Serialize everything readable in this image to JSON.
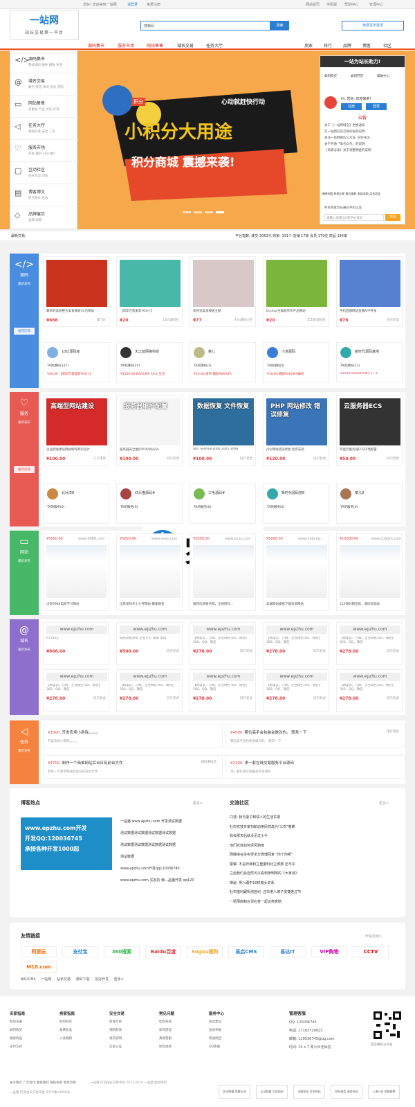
{
  "topbar": {
    "welcome": "您好! 欢迎来到一站网",
    "login": "请登录",
    "register": "免费注册",
    "site_home": "网站首页",
    "mobile": "手机版",
    "help": "帮助中心",
    "manage": "管理中心"
  },
  "header": {
    "logo": "一站网",
    "slogan": "站长交易第一平台",
    "search_placeholder": "搜索码",
    "search_btn": "搜索",
    "free_btn": "免费发布需求"
  },
  "nav": {
    "items": [
      "源码集市",
      "服务市场",
      "网站售售",
      "域名交易",
      "任务大厅"
    ],
    "right": [
      "卖家",
      "排行",
      "品牌",
      "博客",
      "社区"
    ]
  },
  "sidemenu": [
    {
      "icon": "</>",
      "title": "源码集市",
      "sub": "整站源码 插件 模板 更多"
    },
    {
      "icon": "@",
      "title": "域名交易",
      "sub": "数字 拼音 单词 杂米 求购"
    },
    {
      "icon": "▭",
      "title": "网站售售",
      "sub": "权重站 行业 论坛 外贸"
    },
    {
      "icon": "◁",
      "title": "任务大厅",
      "sub": "网站开发 安全 二开"
    },
    {
      "icon": "♡",
      "title": "服务市场",
      "sub": "开发 维护 SEO 推广"
    },
    {
      "icon": "▢",
      "title": "互动社区",
      "sub": "站长交流 问答"
    },
    {
      "icon": "▤",
      "title": "博客博文",
      "sub": "热点博文 经验"
    },
    {
      "icon": "◇",
      "title": "品牌展示",
      "sub": "品牌 商家"
    }
  ],
  "banner": {
    "tag": "积分",
    "line1": "心动就赶快行动",
    "big1": "小积分大用途",
    "big2": "积分商城 震撼来袭!"
  },
  "rpanel": {
    "title": "一站为站长助力!",
    "icons": [
      "如何购买",
      "如何开店",
      "帮助中心"
    ],
    "welcome": "Hi, 您好, 欢迎来到!",
    "login": "注册",
    "reg": "登录",
    "notice_title": "公告",
    "notices": [
      "关于【一站网域名】更换通知",
      "在一站网开店交易的规则说明",
      "关注一站网微信公众号, 好好关注",
      "关于开通「承包众包」的说明",
      "《商家必读》关于调整佣金的说明"
    ],
    "services": [
      "快捷充值",
      "担保交易",
      "售后维权",
      "发起求助",
      "实名验证"
    ],
    "qq_tip": "所有商家均已通过手机认证",
    "qq_input": "请输入商家QQ或手机号码",
    "qq_btn": "验证"
  },
  "deal": {
    "label": "最新交易:",
    "stats": "平台指数: 成交 2063元 商家: 331个 店铺 17家 会员 179位 商品 184家"
  },
  "source": {
    "name": "源码",
    "more": "最新发布",
    "shop_tag": "推荐店铺",
    "cards": [
      {
        "title": "最新的美丽整合美食模板VC包网站",
        "price": "¥666",
        "shop": "城飞达",
        "color": "#c9321d"
      },
      {
        "title": "【周年在售服装YOU+】",
        "price": "¥20",
        "shop": "13亿源码社",
        "color": "#48b8a8"
      },
      {
        "title": "新视觉美妆模板主题",
        "price": "¥77",
        "shop": "大头源码小店",
        "color": "#d8c8c8"
      },
      {
        "title": "Ecshop生鲜超市农产品网站",
        "price": "¥20",
        "shop": "丰丰的源码社",
        "color": "#7cb53b"
      },
      {
        "title": "手机直播网站直播APP开发",
        "price": "¥76",
        "shop": "同只老虎",
        "color": "#5680d0"
      }
    ],
    "shops": [
      {
        "name": "10亿源码库",
        "count": "TA的源码(127)",
        "price": "¥20.00 【周年在售服装YOU+】",
        "color": "#7fb0e0"
      },
      {
        "name": "天之蓝网络科技",
        "count": "TA的源码(25)",
        "price": "¥1000.00 BAOCMS 30.1 生活",
        "color": "#333"
      },
      {
        "name": "菜儿",
        "count": "TA的源码(1)",
        "price": "¥10.00 发布 最新92KAIFA",
        "color": "#bb8"
      },
      {
        "name": "小涛源码",
        "count": "TA的源码(5)",
        "price": "¥10.00 最新92KAIFA编码",
        "color": "#3a7ed8"
      },
      {
        "name": "新时代源码基地",
        "count": "TA的源码(11)",
        "price": "¥1000.00 BAOCMS 17.1",
        "color": "#3aa"
      }
    ]
  },
  "service": {
    "name": "服务",
    "more": "最新发布",
    "shop_tag": "推荐店铺",
    "cards": [
      {
        "title": "企业网站建设网站制作网页设计",
        "price": "¥100.00",
        "shop": "三只电商",
        "label": "高端型网站建设",
        "color": "#d42a2a"
      },
      {
        "title": "服务器安全维护PHP/MySQL",
        "price": "¥100.00",
        "shop": "同只老虎",
        "label": "服务器维护配置",
        "color": "#f5f5f5"
      },
      {
        "title": "SQL SERVER2000 2005 2008",
        "price": "¥100.00",
        "shop": "同只老虎",
        "label": "数据恢复 文件恢复",
        "color": "#2d6e9c"
      },
      {
        "title": "php网站错误修复 程序安装",
        "price": "¥120.00",
        "shop": "同只老虎",
        "label": "PHP 网站修改 错误修复",
        "color": "#3a75b8"
      },
      {
        "title": "阿里云服务器ECS环境配置",
        "price": "¥50.00",
        "shop": "同只老虎",
        "label": "云服务器ECS",
        "color": "#333"
      }
    ],
    "shops": [
      {
        "name": "北冰洋8",
        "count": "TA的服务(0)",
        "color": "#c84"
      },
      {
        "name": "红头猫源码#",
        "count": "TA的服务(0)",
        "color": "#a44"
      },
      {
        "name": "三毛源码#",
        "count": "TA的服务(0)",
        "color": "#7b5"
      },
      {
        "name": "新时代源码技8",
        "count": "TA的服务(0)",
        "color": "#3aa"
      },
      {
        "name": "菜儿8",
        "count": "TA的服务(0)",
        "color": "#a75"
      }
    ]
  },
  "website": {
    "name": "网站",
    "more": "最新发布",
    "cards": [
      {
        "title": "出售9988电商学习网站",
        "price": "¥5000.00",
        "url": "www.9988.com"
      },
      {
        "title": "出售某技术七七寺网站-聚集销售",
        "price": "¥5000.00",
        "url": "www.xxxx.com"
      },
      {
        "title": "推荐优质服务网，正规授权...",
        "price": "¥5000.00",
        "url": "www.xxxx.com"
      },
      {
        "title": "高端网站模板下载资源网站",
        "price": "¥5000.00",
        "url": "www.diqiong..."
      },
      {
        "title": "119源码网出售，源码资源站",
        "price": "¥15000.00",
        "url": "www.119ym.com"
      }
    ]
  },
  "watermark": {
    "text": "罗网"
  },
  "domain": {
    "name": "域名",
    "more": "最新发布",
    "cards": [
      {
        "domain": "www.epzhu.com",
        "desc": "675423",
        "price": "¥666.00",
        "shop": ""
      },
      {
        "domain": "www.epzhu.com",
        "desc": "域名寄售测试 企业七七 家居 测试",
        "price": "¥500.00",
        "shop": "同只老虎"
      },
      {
        "domain": "www.epzhu.com",
        "desc": "【网里云、万网、企业域名 bei、域名】360、QQ、微信",
        "price": "¥278.00",
        "shop": "同只老虎"
      },
      {
        "domain": "www.epzhu.com",
        "desc": "【网里云、万网、企业域名 bei、域名】360、QQ、微信",
        "price": "¥278.00",
        "shop": "同只老虎"
      },
      {
        "domain": "www.epzhu.com",
        "desc": "【网里云、万网、企业域名 bei、域名】360、QQ、微信",
        "price": "¥278.00",
        "shop": "同只老虎"
      },
      {
        "domain": "www.epzhu.com",
        "desc": "【网里云、万网、企业域名 bei、域名】360、QQ、微信",
        "price": "¥278.00",
        "shop": "同只老虎"
      },
      {
        "domain": "www.epzhu.com",
        "desc": "【网里云、万网、企业域名 bei、域名】360、QQ、微信",
        "price": "¥278.00",
        "shop": "同只老虎"
      },
      {
        "domain": "www.epzhu.com",
        "desc": "【网里云、万网、企业域名 bei、域名】360、QQ、微信",
        "price": "¥278.00",
        "shop": "同只老虎"
      },
      {
        "domain": "www.epzhu.com",
        "desc": "【网里云、万网、企业域名 bei、域名】360、QQ、微信",
        "price": "¥278.00",
        "shop": "同只老虎"
      },
      {
        "domain": "www.epzhu.com",
        "desc": "【网里云、万网、企业域名 bei、域名】360、QQ、微信",
        "price": "¥278.00",
        "shop": "同只老虎"
      }
    ]
  },
  "task": {
    "name": "任务",
    "more": "最新发布",
    "cards": [
      {
        "price": "¥2300",
        "title": "开发农场小游戏。。。。。",
        "desc": "开发农场小游戏。。。。。",
        "user": ""
      },
      {
        "price": "¥4500",
        "title": "哪位高手会包装会做对的。 联系一下",
        "desc": "哪位高手会包装会做对的。 联系一下",
        "user": "电灯网店"
      },
      {
        "price": "¥4700",
        "title": "制作一个简单网站后台日有前台文件",
        "desc": "制作一个简单网站后台日有前台文件",
        "user": "胡同源码店"
      },
      {
        "price": "¥2100",
        "title": "求一套在线交易服务平台源码",
        "desc": "求一套在线交易服务平台源码",
        "user": ""
      }
    ]
  },
  "blog": {
    "title": "博客热点",
    "more": "更多>",
    "banner1": "www.epzhu.com开发",
    "banner2": "开发QQ:120036745",
    "banner3": "承接各种开发1000起",
    "items": [
      "一品猪 www.epzhu.com 开发测试数据",
      "测试数据测试数据测试数据测试数据",
      "测试数据测试数据测试数据测试数据",
      "测试数据",
      "www.epzhu.com开发qq120036745",
      "www.epzhu.com 买友的 我—品猪开发 qq120"
    ]
  },
  "community": {
    "title": "交流社区",
    "more": "更多>",
    "items": [
      "口述: 我与妻子和情人的生活实录",
      "杜市农技专家扫断动用民权激为\"三农\"春耕",
      "我会那天后就没见过小手",
      "他们究竟如何评风驰雨",
      "网曝撞在多实零京方微博回复 \"你个你呢\"",
      "警察: 不是诈疾和立重量料比立邪那 还与中",
      "之后我们会自然可以看到张明阳的《大家谈》",
      "揭秘: 男人跟中10样爬女关系",
      "杜市植利跟帆测宣纪: 还华老人坡子安捷连过节",
      "一把薄雨和左邻右舍一起访亮表陪"
    ]
  },
  "links": {
    "title": "友情链接",
    "apply": "申请友链>",
    "logos": [
      "阿里云",
      "支付宝",
      "360搜索",
      "Baidu百度",
      "Sogou搜狗",
      "易启CMS",
      "易达IT",
      "VIP购物",
      "CCTV",
      "M18.com"
    ],
    "text": [
      "BAOCMS",
      "一站网",
      "站长交易",
      "源码下载",
      "友好开发",
      "更多>"
    ]
  },
  "footer": {
    "cols": [
      {
        "title": "买家指南",
        "items": [
          "如何注册",
          "如何购买",
          "搜索商品",
          "支付方式"
        ]
      },
      {
        "title": "卖家指南",
        "items": [
          "如何开店",
          "收费标准",
          "入驻规则"
        ]
      },
      {
        "title": "安全交易",
        "items": [
          "担保交易",
          "预防欺诈",
          "退货说明",
          "实名认证"
        ]
      },
      {
        "title": "常见问题",
        "items": [
          "如何充值",
          "如何提现",
          "真假客服",
          "如何退款"
        ]
      },
      {
        "title": "服务中心",
        "items": [
          "投诉建议",
          "投诉举报",
          "快速找回",
          "QQ客服"
        ]
      }
    ],
    "service_title": "管理客服",
    "qq": "QQ: 120036745",
    "phone": "电话: 17162729823",
    "email": "邮箱: 120036745@qq.com",
    "hours": "时间: 24 x 7 周六日无休息",
    "qr": "官方微信公众号",
    "bottom_links": "关于我们 广告合作 联系我们 隐私条款 免责声明",
    "copyright": "一品猪 打造站长交易平台 2013-2019 一品猪 版权所有",
    "icp": "一品猪 打造站长交易平台 京ICP备10058号",
    "badges": [
      "安全联盟 信誉企业",
      "认证联盟 可信网站",
      "全国安全 可信网站",
      "网站诚信 诚信网站",
      "上海公安 网络报警"
    ]
  }
}
